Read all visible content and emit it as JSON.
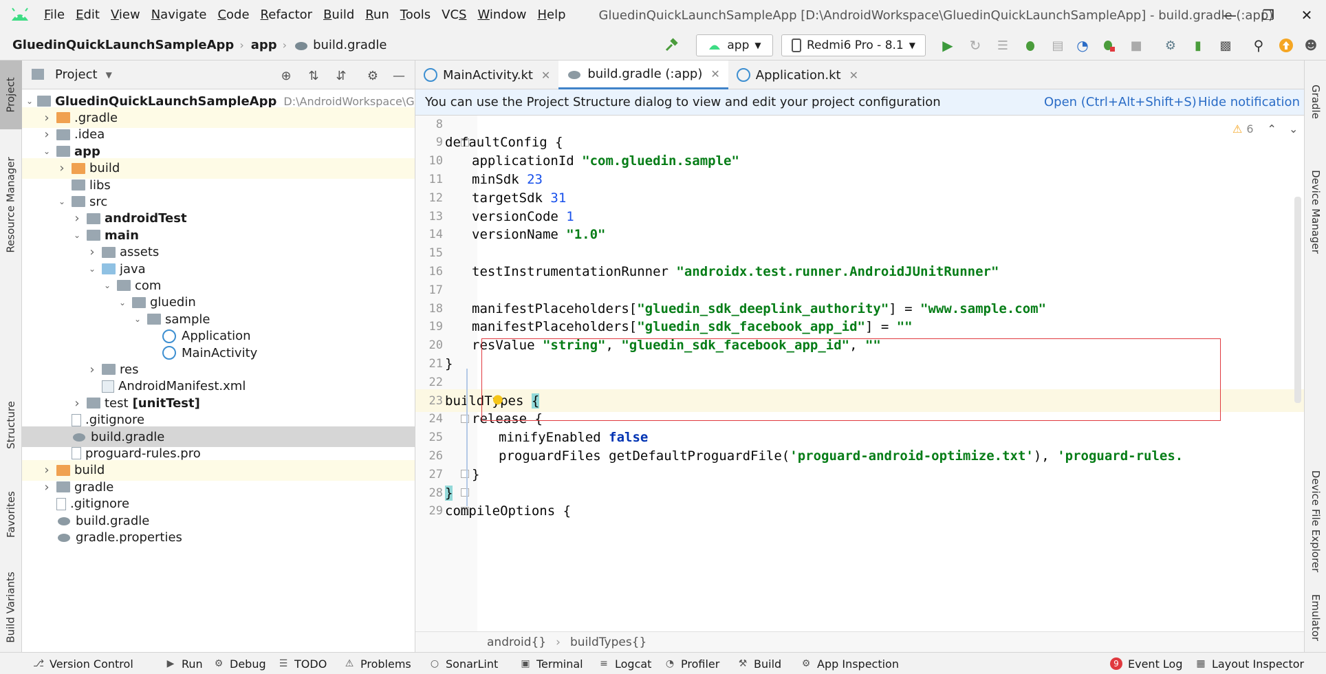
{
  "menu": {
    "items": [
      "File",
      "Edit",
      "View",
      "Navigate",
      "Code",
      "Refactor",
      "Build",
      "Run",
      "Tools",
      "VCS",
      "Window",
      "Help"
    ],
    "underline": [
      "F",
      "E",
      "V",
      "N",
      "C",
      "R",
      "B",
      "R",
      "T",
      "S",
      "W",
      "H"
    ]
  },
  "window": {
    "title": "GluedinQuickLaunchSampleApp [D:\\AndroidWorkspace\\GluedinQuickLaunchSampleApp] - build.gradle (:app)"
  },
  "nav": {
    "crumbs": [
      "GluedinQuickLaunchSampleApp",
      "app",
      "build.gradle"
    ],
    "run_config": "app",
    "device": "Redmi6 Pro - 8.1"
  },
  "left_tabs": [
    "Project",
    "Resource Manager",
    "Structure",
    "Favorites",
    "Build Variants"
  ],
  "right_tabs": [
    "Gradle",
    "Device Manager",
    "Device File Explorer",
    "Emulator"
  ],
  "project": {
    "title": "Project",
    "tree": [
      {
        "label": "GluedinQuickLaunchSampleApp",
        "path": "D:\\AndroidWorkspace\\Glue",
        "bold": true,
        "depth": 0,
        "arrow": "open",
        "icon": "folder-gray",
        "hl": false
      },
      {
        "label": ".gradle",
        "depth": 1,
        "arrow": "closed",
        "icon": "folder-orange",
        "hl": true
      },
      {
        "label": ".idea",
        "depth": 1,
        "arrow": "closed",
        "icon": "folder-gray",
        "hl": false
      },
      {
        "label": "app",
        "depth": 1,
        "arrow": "open",
        "icon": "folder-gray",
        "bold": true,
        "hl": false
      },
      {
        "label": "build",
        "depth": 2,
        "arrow": "closed",
        "icon": "folder-orange",
        "hl": true
      },
      {
        "label": "libs",
        "depth": 2,
        "arrow": "none",
        "icon": "folder-gray",
        "hl": false
      },
      {
        "label": "src",
        "depth": 2,
        "arrow": "open",
        "icon": "folder-gray",
        "hl": false
      },
      {
        "label": "androidTest",
        "depth": 3,
        "arrow": "closed",
        "icon": "folder-gray",
        "bold": true,
        "hl": false
      },
      {
        "label": "main",
        "depth": 3,
        "arrow": "open",
        "icon": "folder-gray",
        "bold": true,
        "hl": false
      },
      {
        "label": "assets",
        "depth": 4,
        "arrow": "closed",
        "icon": "folder-gray",
        "hl": false
      },
      {
        "label": "java",
        "depth": 4,
        "arrow": "open",
        "icon": "folder-blue",
        "hl": false
      },
      {
        "label": "com",
        "depth": 5,
        "arrow": "open",
        "icon": "folder-gray",
        "hl": false
      },
      {
        "label": "gluedin",
        "depth": 6,
        "arrow": "open",
        "icon": "folder-gray",
        "hl": false
      },
      {
        "label": "sample",
        "depth": 7,
        "arrow": "open",
        "icon": "folder-gray",
        "hl": false
      },
      {
        "label": "Application",
        "depth": 8,
        "arrow": "none",
        "icon": "kotlin",
        "hl": false
      },
      {
        "label": "MainActivity",
        "depth": 8,
        "arrow": "none",
        "icon": "kotlin",
        "hl": false
      },
      {
        "label": "res",
        "depth": 4,
        "arrow": "closed",
        "icon": "folder-gray",
        "hl": false
      },
      {
        "label": "AndroidManifest.xml",
        "depth": 4,
        "arrow": "none",
        "icon": "manifest",
        "hl": false
      },
      {
        "label": "test",
        "suffix": "[unitTest]",
        "depth": 3,
        "arrow": "closed",
        "icon": "folder-gray",
        "hl": false
      },
      {
        "label": ".gitignore",
        "depth": 2,
        "arrow": "none",
        "icon": "file",
        "hl": false
      },
      {
        "label": "build.gradle",
        "depth": 2,
        "arrow": "none",
        "icon": "gradle",
        "hl": false,
        "sel": true
      },
      {
        "label": "proguard-rules.pro",
        "depth": 2,
        "arrow": "none",
        "icon": "file",
        "hl": false
      },
      {
        "label": "build",
        "depth": 1,
        "arrow": "closed",
        "icon": "folder-orange",
        "hl": true
      },
      {
        "label": "gradle",
        "depth": 1,
        "arrow": "closed",
        "icon": "folder-gray",
        "hl": false
      },
      {
        "label": ".gitignore",
        "depth": 1,
        "arrow": "none",
        "icon": "file",
        "hl": false
      },
      {
        "label": "build.gradle",
        "depth": 1,
        "arrow": "none",
        "icon": "gradle",
        "hl": false
      },
      {
        "label": "gradle.properties",
        "depth": 1,
        "arrow": "none",
        "icon": "gradle",
        "hl": false
      }
    ]
  },
  "tabs": [
    {
      "label": "MainActivity.kt",
      "icon": "kotlin",
      "active": false
    },
    {
      "label": "build.gradle (:app)",
      "icon": "gradle",
      "active": true
    },
    {
      "label": "Application.kt",
      "icon": "kotlin",
      "active": false
    }
  ],
  "notification": {
    "message": "You can use the Project Structure dialog to view and edit your project configuration",
    "open_link": "Open (Ctrl+Alt+Shift+S)",
    "hide_link": "Hide notification"
  },
  "editor": {
    "warnings": "6",
    "lines": [
      {
        "n": "8",
        "indent": 0,
        "segs": []
      },
      {
        "n": "9",
        "indent": 1,
        "segs": [
          [
            "t",
            "defaultConfig {"
          ]
        ]
      },
      {
        "n": "10",
        "indent": 2,
        "segs": [
          [
            "t",
            "applicationId "
          ],
          [
            "s",
            "\"com.gluedin.sample\""
          ]
        ]
      },
      {
        "n": "11",
        "indent": 2,
        "segs": [
          [
            "t",
            "minSdk "
          ],
          [
            "n",
            "23"
          ]
        ]
      },
      {
        "n": "12",
        "indent": 2,
        "segs": [
          [
            "t",
            "targetSdk "
          ],
          [
            "n",
            "31"
          ]
        ]
      },
      {
        "n": "13",
        "indent": 2,
        "segs": [
          [
            "t",
            "versionCode "
          ],
          [
            "n",
            "1"
          ]
        ]
      },
      {
        "n": "14",
        "indent": 2,
        "segs": [
          [
            "t",
            "versionName "
          ],
          [
            "s",
            "\"1.0\""
          ]
        ]
      },
      {
        "n": "15",
        "indent": 0,
        "segs": []
      },
      {
        "n": "16",
        "indent": 2,
        "segs": [
          [
            "t",
            "testInstrumentationRunner "
          ],
          [
            "s",
            "\"androidx.test.runner.AndroidJUnitRunner\""
          ]
        ]
      },
      {
        "n": "17",
        "indent": 0,
        "segs": []
      },
      {
        "n": "18",
        "indent": 2,
        "segs": [
          [
            "t",
            "manifestPlaceholders["
          ],
          [
            "s",
            "\"gluedin_sdk_deeplink_authority\""
          ],
          [
            "t",
            "] = "
          ],
          [
            "s",
            "\"www.sample.com\""
          ]
        ]
      },
      {
        "n": "19",
        "indent": 2,
        "segs": [
          [
            "t",
            "manifestPlaceholders["
          ],
          [
            "s",
            "\"gluedin_sdk_facebook_app_id\""
          ],
          [
            "t",
            "] = "
          ],
          [
            "s",
            "\"\""
          ]
        ]
      },
      {
        "n": "20",
        "indent": 2,
        "segs": [
          [
            "t",
            "resValue "
          ],
          [
            "s",
            "\"string\""
          ],
          [
            "t",
            ", "
          ],
          [
            "s",
            "\"gluedin_sdk_facebook_app_id\""
          ],
          [
            "t",
            ", "
          ],
          [
            "s",
            "\"\""
          ]
        ]
      },
      {
        "n": "21",
        "indent": 1,
        "segs": [
          [
            "t",
            "}"
          ]
        ]
      },
      {
        "n": "22",
        "indent": 0,
        "segs": []
      },
      {
        "n": "23",
        "indent": 1,
        "segs": [
          [
            "t",
            "buildTypes "
          ],
          [
            "b",
            "{"
          ]
        ],
        "current": true
      },
      {
        "n": "24",
        "indent": 2,
        "segs": [
          [
            "t",
            "release {"
          ]
        ]
      },
      {
        "n": "25",
        "indent": 3,
        "segs": [
          [
            "t",
            "minifyEnabled "
          ],
          [
            "k",
            "false"
          ]
        ]
      },
      {
        "n": "26",
        "indent": 3,
        "segs": [
          [
            "t",
            "proguardFiles getDefaultProguardFile("
          ],
          [
            "s",
            "'proguard-android-optimize.txt'"
          ],
          [
            "t",
            "), "
          ],
          [
            "s",
            "'proguard-rules."
          ]
        ]
      },
      {
        "n": "27",
        "indent": 2,
        "segs": [
          [
            "t",
            "}"
          ]
        ]
      },
      {
        "n": "28",
        "indent": 1,
        "segs": [
          [
            "b",
            "}"
          ]
        ]
      },
      {
        "n": "29",
        "indent": 1,
        "segs": [
          [
            "t",
            "compileOptions {"
          ]
        ]
      }
    ]
  },
  "editor_crumbs": [
    "android{}",
    "buildTypes{}"
  ],
  "status": {
    "items": [
      "Version Control",
      "Run",
      "Debug",
      "TODO",
      "Problems",
      "SonarLint",
      "Terminal",
      "Logcat",
      "Profiler",
      "Build",
      "App Inspection"
    ],
    "event_log": "Event Log",
    "event_count": "9",
    "layout_inspector": "Layout Inspector"
  }
}
